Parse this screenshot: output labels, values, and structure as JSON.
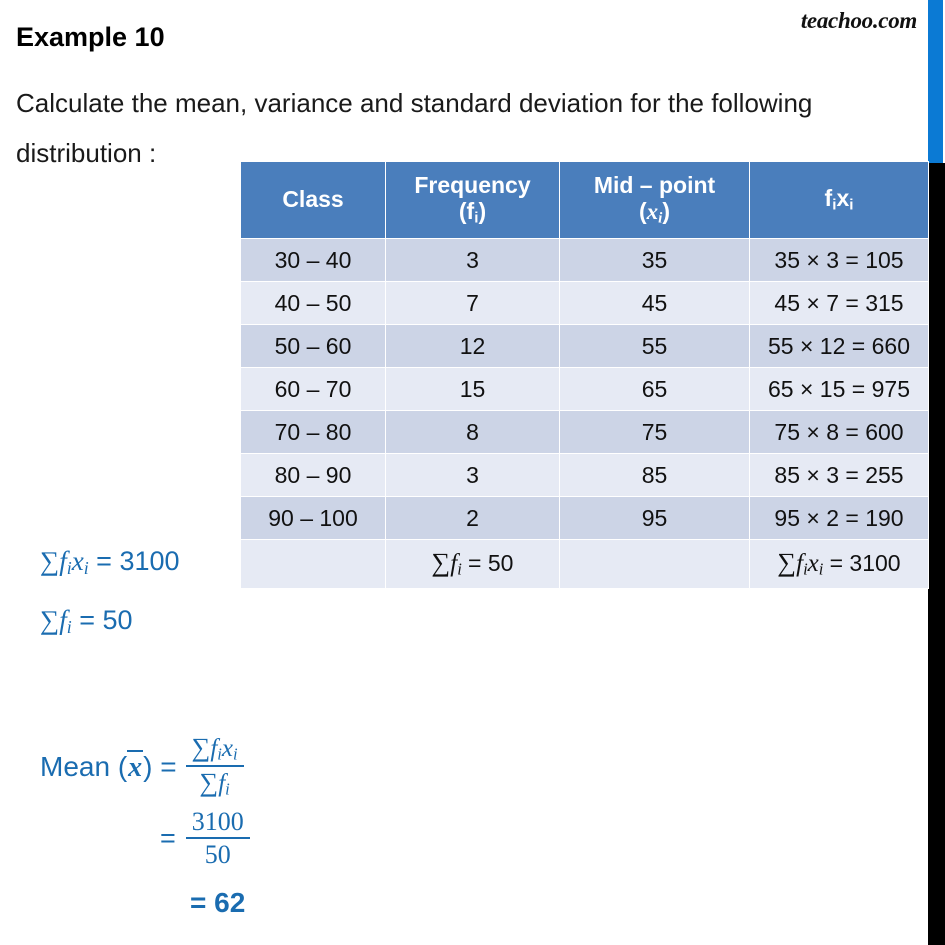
{
  "brand": "teachoo.com",
  "heading": "Example 10",
  "question": {
    "line1": "Calculate the mean, variance and standard deviation for the following",
    "line2": "distribution :"
  },
  "table": {
    "headers": {
      "class": "Class",
      "frequency_line1": "Frequency",
      "frequency_line2_open": "(f",
      "frequency_sub": "i",
      "frequency_line2_close": ")",
      "midpoint_line1": "Mid – point",
      "midpoint_line2_open": "(",
      "midpoint_var": "x",
      "midpoint_sub": "i",
      "midpoint_line2_close": ")",
      "fx_f": "f",
      "fx_sub1": "i",
      "fx_x": "x",
      "fx_sub2": "i"
    },
    "rows": [
      {
        "class": "30 – 40",
        "frequency": "3",
        "midpoint": "35",
        "fx": "35 ×  3 = 105"
      },
      {
        "class": "40 – 50",
        "frequency": "7",
        "midpoint": "45",
        "fx": "45 × 7 = 315"
      },
      {
        "class": "50 – 60",
        "frequency": "12",
        "midpoint": "55",
        "fx": "55 × 12 = 660"
      },
      {
        "class": "60 – 70",
        "frequency": "15",
        "midpoint": "65",
        "fx": "65 × 15 = 975"
      },
      {
        "class": "70 – 80",
        "frequency": "8",
        "midpoint": "75",
        "fx": "75 × 8 = 600"
      },
      {
        "class": "80 – 90",
        "frequency": "3",
        "midpoint": "85",
        "fx": "85 × 3 = 255"
      },
      {
        "class": "90 – 100",
        "frequency": "2",
        "midpoint": "95",
        "fx": "95 × 2 = 190"
      }
    ],
    "totals": {
      "class": "",
      "sigma": "∑",
      "freq_var": "f",
      "freq_sub": "i",
      "freq_eq": "= 50",
      "midpoint": "",
      "fx_var1": "f",
      "fx_sub1": "i",
      "fx_var2": "x",
      "fx_sub2": "i",
      "fx_eq": "= 3100"
    }
  },
  "summary": {
    "sigma": "∑",
    "fx_f": "f",
    "fx_sub1": "i",
    "fx_x": "x",
    "fx_sub2": "i",
    "fx_eq": "= 3100",
    "f_var": "f",
    "f_sub": "i",
    "f_eq": "= 50"
  },
  "mean": {
    "label_prefix": "Mean (",
    "label_var": "x",
    "label_suffix": ") =",
    "numerator_sigma": "∑",
    "numerator_f": "f",
    "numerator_fsub": "i",
    "numerator_x": "x",
    "numerator_xsub": "i",
    "denominator_sigma": "∑",
    "denominator_f": "f",
    "denominator_fsub": "i",
    "equals": "=",
    "value_numerator": "3100",
    "value_denominator": "50",
    "result": "= 62"
  },
  "colors": {
    "header_blue": "#4a7ebc",
    "row_dark": "#ccd4e6",
    "row_light": "#e6eaf4",
    "accent_blue": "#1a6cb0",
    "bar_blue": "#0b7ad4"
  }
}
